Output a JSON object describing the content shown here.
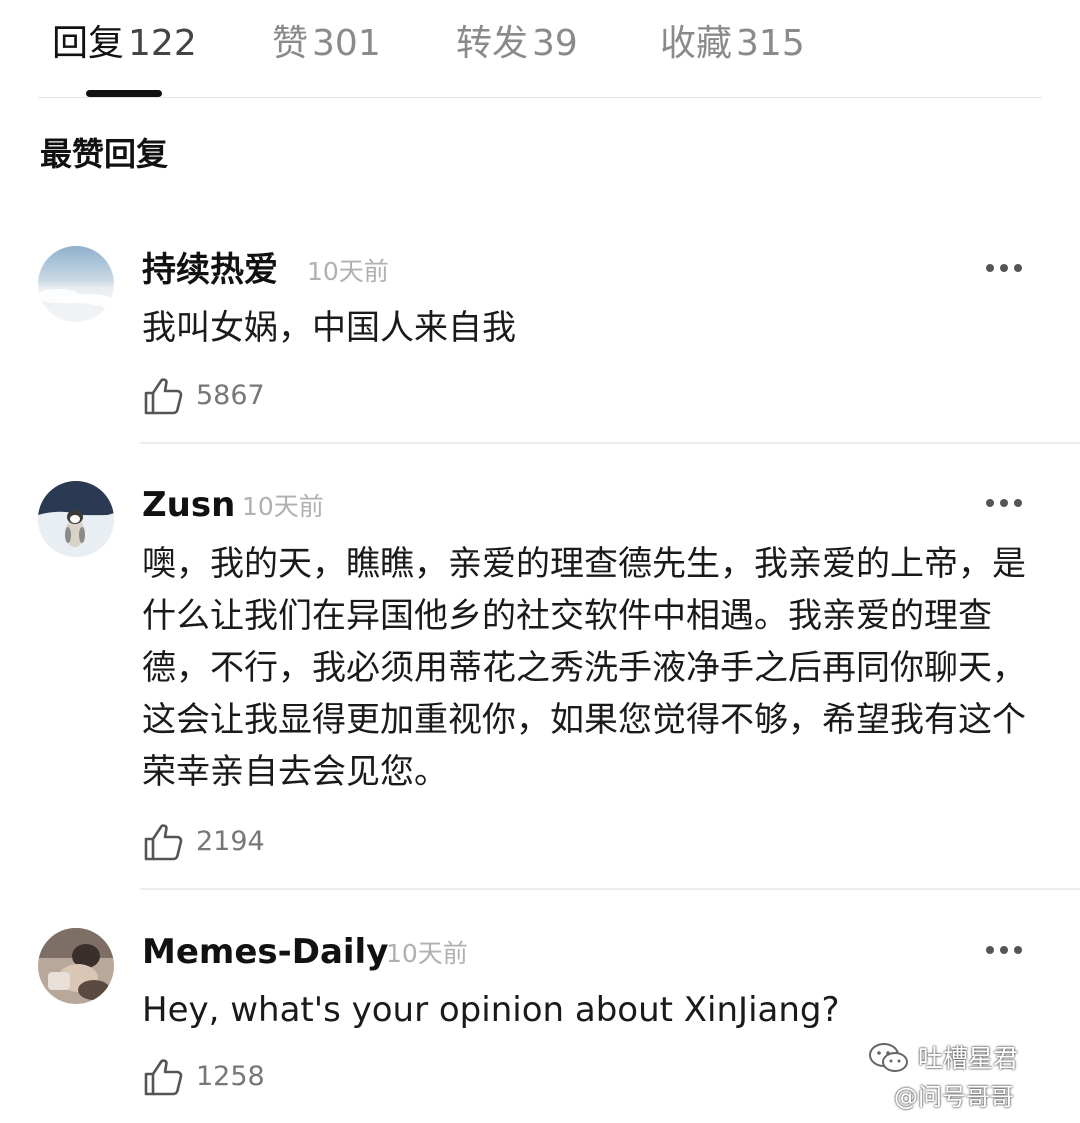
{
  "tabs": [
    {
      "label": "回复",
      "count": "122",
      "active": true
    },
    {
      "label": "赞",
      "count": "301",
      "active": false
    },
    {
      "label": "转发",
      "count": "39",
      "active": false
    },
    {
      "label": "收藏",
      "count": "315",
      "active": false
    }
  ],
  "section_title": "最赞回复",
  "comments": [
    {
      "username": "持续热爱",
      "time": "10天前",
      "text": "我叫女娲，中国人来自我",
      "likes": "5867",
      "avatar": "clouds-avatar"
    },
    {
      "username": "Zusn",
      "time": "10天前",
      "text": "噢，我的天，瞧瞧，亲爱的理查德先生，我亲爱的上帝，是什么让我们在异国他乡的社交软件中相遇。我亲爱的理查德，不行，我必须用蒂花之秀洗手液净手之后再同你聊天，这会让我显得更加重视你，如果您觉得不够，希望我有这个荣幸亲自去会见您。",
      "likes": "2194",
      "avatar": "penguin-avatar"
    },
    {
      "username": "Memes-Daily",
      "time": "10天前",
      "text": "Hey, what's your opinion about XinJiang?",
      "likes": "1258",
      "avatar": "photo-avatar"
    }
  ],
  "watermark": {
    "line1": "吐槽星君",
    "line2": "@问号哥哥"
  },
  "colors": {
    "text_primary": "#111111",
    "text_secondary": "#8a8a8a",
    "time": "#b0b0b0",
    "divider": "#ececec"
  }
}
